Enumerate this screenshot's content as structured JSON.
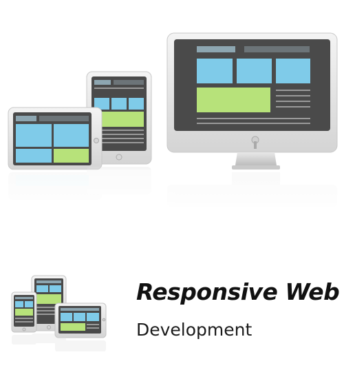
{
  "headline": "Responsive Web",
  "subline": "Development",
  "colors": {
    "device_frame": "#e4e4e4",
    "screen": "#4a4a4a",
    "blue_tile": "#7fcbe9",
    "green_tile": "#b7e27a",
    "header_bar": "#8da6b1",
    "text_lines": "#9a9a9a"
  },
  "icons": [
    "desktop-monitor-icon",
    "tablet-portrait-icon",
    "tablet-landscape-icon",
    "phone-icon"
  ]
}
